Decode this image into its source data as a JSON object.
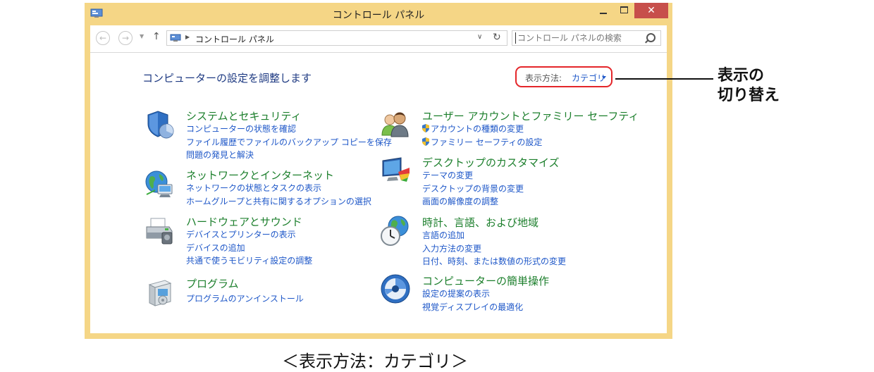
{
  "window": {
    "title": "コントロール パネル",
    "close_glyph": "✕"
  },
  "nav": {
    "back_icon": "back-arrow-icon",
    "forward_icon": "forward-arrow-icon",
    "up_glyph": "↑",
    "address_path": "コントロール パネル",
    "refresh_glyph": "↻",
    "search_placeholder": "コントロール パネルの検索"
  },
  "heading": "コンピューターの設定を調整します",
  "view_by": {
    "label": "表示方法:",
    "value": "カテゴリ"
  },
  "categories": [
    {
      "title": "システムとセキュリティ",
      "icon": "shield-chart-icon",
      "links": [
        "コンピューターの状態を確認",
        "ファイル履歴でファイルのバックアップ コピーを保存",
        "問題の発見と解決"
      ]
    },
    {
      "title": "ネットワークとインターネット",
      "icon": "globe-network-icon",
      "links": [
        "ネットワークの状態とタスクの表示",
        "ホームグループと共有に関するオプションの選択"
      ]
    },
    {
      "title": "ハードウェアとサウンド",
      "icon": "printer-icon",
      "links": [
        "デバイスとプリンターの表示",
        "デバイスの追加",
        "共通で使うモビリティ設定の調整"
      ]
    },
    {
      "title": "プログラム",
      "icon": "program-box-icon",
      "links": [
        "プログラムのアンインストール"
      ]
    },
    {
      "title": "ユーザー アカウントとファミリー セーフティ",
      "icon": "users-icon",
      "links": [
        "アカウントの種類の変更",
        "ファミリー セーフティの設定"
      ]
    },
    {
      "title": "デスクトップのカスタマイズ",
      "icon": "monitor-palette-icon",
      "links": [
        "テーマの変更",
        "デスクトップの背景の変更",
        "画面の解像度の調整"
      ]
    },
    {
      "title": "時計、言語、および地域",
      "icon": "clock-globe-icon",
      "links": [
        "言語の追加",
        "入力方法の変更",
        "日付、時刻、または数値の形式の変更"
      ]
    },
    {
      "title": "コンピューターの簡単操作",
      "icon": "ease-of-access-icon",
      "links": [
        "設定の提案の表示",
        "視覚ディスプレイの最適化"
      ]
    }
  ],
  "annotation": {
    "line1": "表示の",
    "line2": "切り替え"
  },
  "caption": "＜表示方法：カテゴリ＞",
  "colors": {
    "frame": "#f5d686",
    "close": "#c74f4b",
    "highlight": "#e4262a",
    "category_title": "#1c7f2c",
    "link": "#1e57c8"
  }
}
